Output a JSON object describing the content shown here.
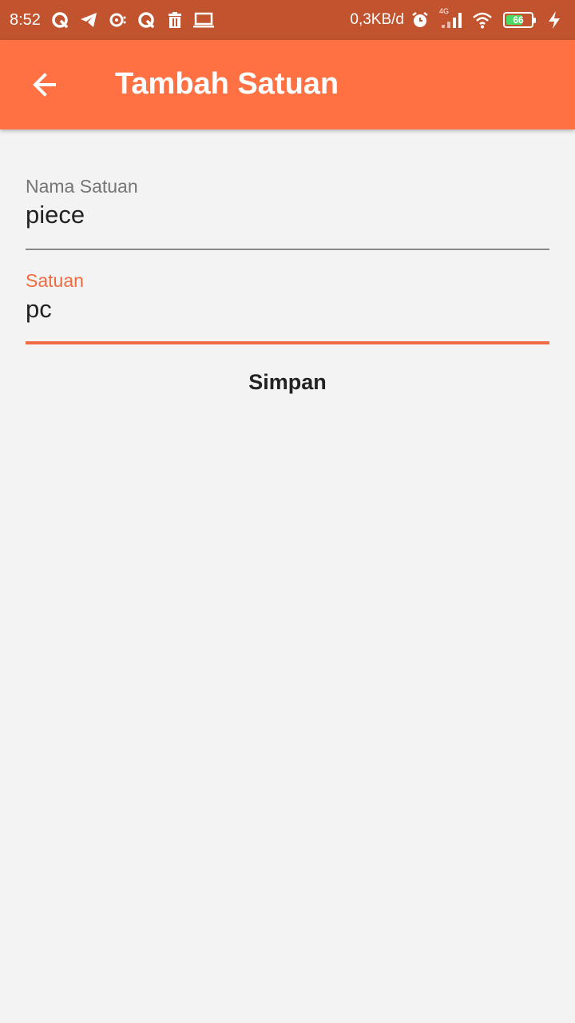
{
  "status_bar": {
    "time": "8:52",
    "network_speed": "0,3KB/d",
    "signal_type": "4G",
    "battery_level": "66",
    "battery_fraction": 0.66,
    "left_icons": [
      "q-app-icon",
      "telegram-icon",
      "q-chat-icon",
      "q-app-icon-2",
      "trash-icon",
      "laptop-icon"
    ],
    "right_icons": [
      "alarm-icon",
      "signal-icon",
      "wifi-icon",
      "battery-icon",
      "charging-icon"
    ]
  },
  "app_bar": {
    "title": "Tambah Satuan",
    "back_icon": "arrow-left-icon"
  },
  "form": {
    "nama_satuan": {
      "label": "Nama Satuan",
      "value": "piece"
    },
    "satuan": {
      "label": "Satuan",
      "value": "pc"
    },
    "submit_label": "Simpan"
  },
  "colors": {
    "status_bar": "#c1532f",
    "app_bar": "#ff7043",
    "accent": "#ef6c42",
    "background": "#f3f3f3"
  }
}
